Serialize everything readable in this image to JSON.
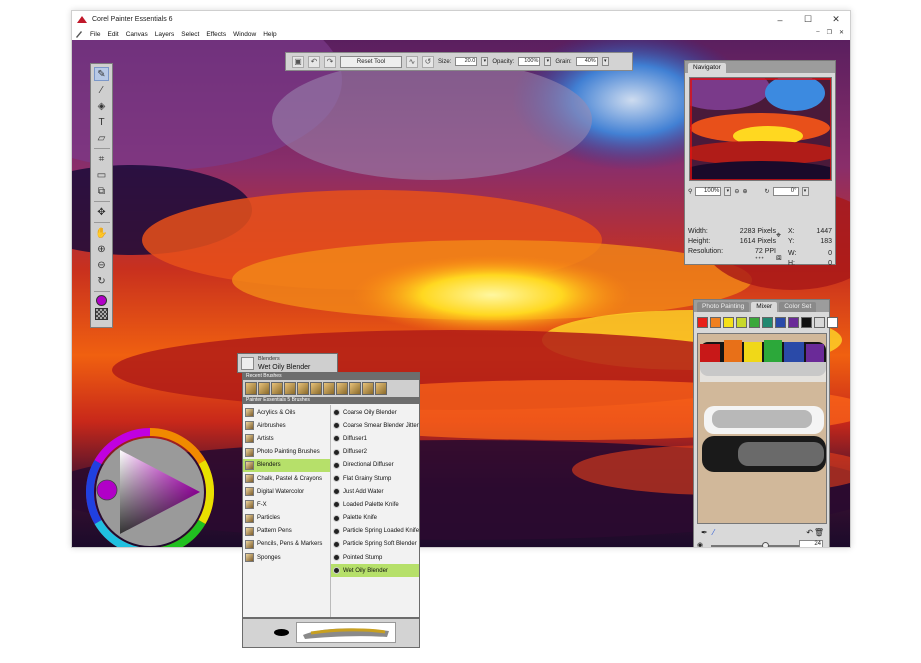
{
  "window": {
    "title": "Corel Painter Essentials 6",
    "controls": {
      "minimize": "–",
      "maximize": "☐",
      "close": "✕"
    }
  },
  "menu": [
    "File",
    "Edit",
    "Canvas",
    "Layers",
    "Select",
    "Effects",
    "Window",
    "Help"
  ],
  "menu_controls": {
    "minimize": "–",
    "restore": "❐",
    "close": "✕"
  },
  "propbar": {
    "reset_label": "Reset Tool",
    "size_label": "Size:",
    "size_value": "20.0",
    "opacity_label": "Opacity:",
    "opacity_value": "100%",
    "grain_label": "Grain:",
    "grain_value": "40%"
  },
  "tools": [
    "brush-icon",
    "dropper-icon",
    "paint-bucket-icon",
    "text-icon",
    "eraser-icon",
    "crop-icon",
    "rectangle-select-icon",
    "transform-icon",
    "layer-adjuster-icon",
    "grabber-icon",
    "zoom-in-icon",
    "zoom-out-icon",
    "rotate-page-icon"
  ],
  "navigator": {
    "tab": "Navigator",
    "zoom": "100%",
    "rotation": "0°",
    "width_label": "Width:",
    "width_value": "2283 Pixels",
    "height_label": "Height:",
    "height_value": "1614 Pixels",
    "resolution_label": "Resolution:",
    "resolution_value": "72 PPI",
    "x_label": "X:",
    "x_value": "1447",
    "y_label": "Y:",
    "y_value": "183",
    "w_label": "W:",
    "w_value": "0",
    "h_label": "H:",
    "h_value": "0"
  },
  "mixer": {
    "tabs": [
      "Photo Painting",
      "Mixer",
      "Color Set"
    ],
    "active_tab": "Mixer",
    "swatches": [
      "#e8201a",
      "#f08020",
      "#f5e018",
      "#c8d82a",
      "#3aa83a",
      "#208870",
      "#2a4aa8",
      "#6a2a98",
      "#111111",
      "#d8d8d8",
      "#ffffff"
    ],
    "brush_size": "24",
    "brush_size_level": 0.6
  },
  "brush": {
    "category": "Blenders",
    "variant": "Wet Oily Blender",
    "recent_label": "Recent Brushes",
    "library_label": "Painter Essentials 5 Brushes",
    "categories": [
      "Acrylics & Oils",
      "Airbrushes",
      "Artists",
      "Photo Painting Brushes",
      "Blenders",
      "Chalk, Pastel & Crayons",
      "Digital Watercolor",
      "F-X",
      "Particles",
      "Pattern Pens",
      "Pencils, Pens & Markers",
      "Sponges"
    ],
    "selected_category": "Blenders",
    "variants": [
      "Coarse Oily Blender",
      "Coarse Smear Blender Jitter",
      "Diffuser1",
      "Diffuser2",
      "Directional Diffuser",
      "Flat Grainy Stump",
      "Just Add Water",
      "Loaded Palette Knife",
      "Palette Knife",
      "Particle Spring Loaded Knife",
      "Particle Spring Soft Blender",
      "Pointed Stump",
      "Wet Oily Blender"
    ],
    "selected_variant": "Wet Oily Blender"
  },
  "colors": {
    "main_color": "#b100c7",
    "accent_select": "#b6e06a"
  }
}
